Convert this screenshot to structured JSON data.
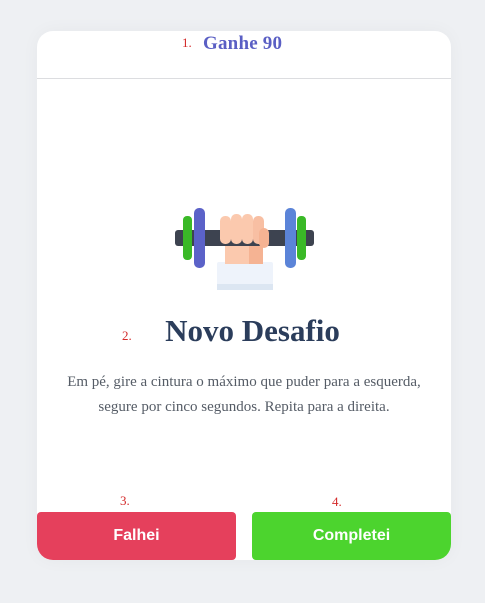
{
  "markers": {
    "m1": "1.",
    "m2": "2.",
    "m3": "3.",
    "m4": "4."
  },
  "header": {
    "reward": "Ganhe 90"
  },
  "main": {
    "illustration_icon": "dumbbell-lift-icon",
    "title": "Novo Desafio",
    "description": "Em pé, gire a cintura o máximo que puder para a esquerda, segure por cinco segundos. Repita para a direita."
  },
  "actions": {
    "fail_label": "Falhei",
    "complete_label": "Completei"
  },
  "colors": {
    "reward": "#5a5fc4",
    "title": "#2b3d5b",
    "fail_button": "#e5405c",
    "complete_button": "#4cd42e",
    "marker": "#d42a2a"
  }
}
